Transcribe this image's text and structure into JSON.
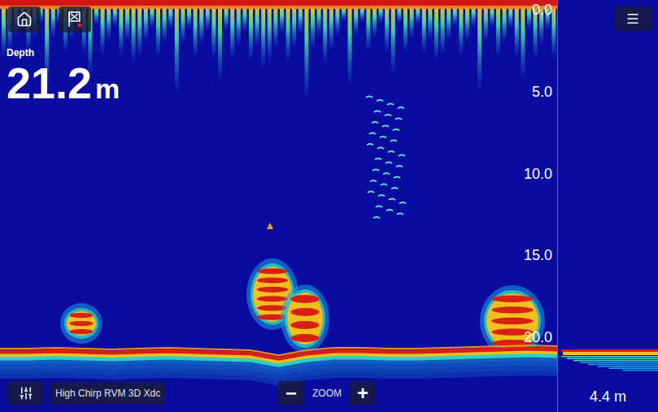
{
  "depth": {
    "label": "Depth",
    "value": "21.2",
    "unit": "m"
  },
  "scale": {
    "ticks": [
      "0.0",
      "5.0",
      "10.0",
      "15.0",
      "20.0"
    ]
  },
  "channel": {
    "name": "High Chirp RVM 3D Xdc"
  },
  "zoom": {
    "label": "ZOOM",
    "out": "−",
    "in": "+"
  },
  "a_scope": {
    "reading": "4.4 m"
  },
  "bottom_profile": [
    20.9,
    20.9,
    20.85,
    20.9,
    20.95,
    20.9,
    20.85,
    20.9,
    20.95,
    21.0,
    21.3,
    21.0,
    20.85,
    20.85,
    20.9,
    20.9,
    20.85,
    20.8,
    20.75,
    20.7,
    20.75
  ]
}
